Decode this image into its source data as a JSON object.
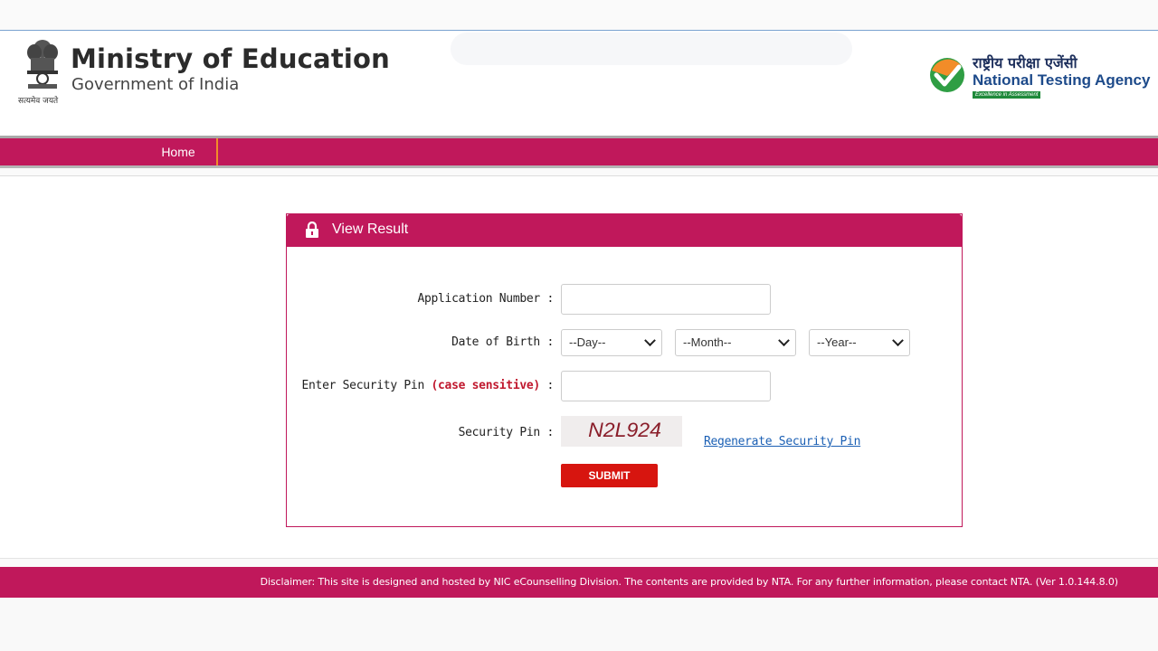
{
  "header": {
    "ministry_title": "Ministry of Education",
    "ministry_subtitle": "Government of India",
    "emblem_motto": "सत्यमेव जयते",
    "emblem_icon": "state-emblem-icon",
    "agency_hindi": "राष्ट्रीय परीक्षा एजेंसी",
    "agency_name": "National Testing Agency",
    "agency_tagline": "Excellence in Assessment",
    "agency_logo_icon": "nta-checkmark-logo"
  },
  "nav": {
    "home_label": "Home"
  },
  "form": {
    "title": "View Result",
    "title_icon": "lock-icon",
    "application_number_label": "Application Number :",
    "application_number_value": "",
    "dob_label": "Date of Birth :",
    "dob_day": "--Day--",
    "dob_month": "--Month--",
    "dob_year": "--Year--",
    "security_pin_label_prefix": "Enter Security Pin",
    "security_pin_label_hint": "(case sensitive)",
    "security_pin_label_suffix": " :",
    "security_pin_value": "",
    "captcha_label": "Security Pin :",
    "captcha_text": "N2L924",
    "regenerate_label": "Regenerate Security Pin",
    "submit_label": "SUBMIT"
  },
  "footer": {
    "disclaimer": "Disclaimer: This site is designed and hosted by NIC eCounselling Division. The contents are provided by NTA. For any further information, please contact NTA. (Ver 1.0.144.8.0)"
  },
  "colors": {
    "brand": "#c0185b",
    "submit": "#d7150f",
    "link": "#1a5fb4",
    "nav_separator": "#f28c28"
  }
}
